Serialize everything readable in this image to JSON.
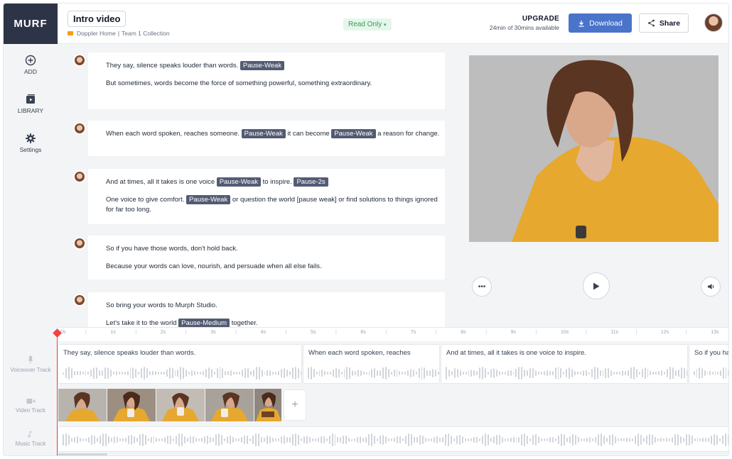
{
  "app": {
    "logo": "MURF"
  },
  "sidebar": {
    "items": [
      {
        "label": "ADD",
        "icon": "plus-circle-icon"
      },
      {
        "label": "LIBRARY",
        "icon": "library-icon"
      },
      {
        "label": "Settings",
        "icon": "gear-icon"
      }
    ]
  },
  "header": {
    "title": "Intro video",
    "breadcrumb": [
      "Doppler Home",
      "|",
      "Team 1 Collection"
    ],
    "mode": "Read Only",
    "mode_caret": "▾",
    "upgrade_label": "UPGRADE",
    "usage": "24min of 30mins available",
    "download_label": "Download",
    "share_label": "Share"
  },
  "script": {
    "blocks": [
      {
        "lines": [
          [
            "They say, silence speaks louder than words.",
            {
              "tag": "Pause-Weak"
            }
          ],
          [
            "But sometimes,   words become the force of something powerful, something extraordinary."
          ]
        ]
      },
      {
        "lines": [
          [
            "When each word spoken, reaches someone.",
            {
              "tag": "Pause-Weak"
            },
            "it can become",
            {
              "tag": "Pause-Weak"
            },
            "a reason for change."
          ]
        ]
      },
      {
        "lines": [
          [
            "And at times, all it takes is one voice",
            {
              "tag": "Pause-Weak"
            },
            "to inspire.",
            {
              "tag": "Pause-2s"
            }
          ],
          [
            "One voice to give comfort.",
            {
              "tag": "Pause-Weak"
            },
            "or question the world  [pause weak] or find solutions to things ignored for far too long."
          ]
        ]
      },
      {
        "lines": [
          [
            "So if you have those words, don't hold back."
          ],
          [
            "Because your words can love, nourish, and persuade when all else fails."
          ]
        ]
      },
      {
        "lines": [
          [
            "So bring your words to Murph Studio."
          ],
          [
            "Let's take it to the world",
            {
              "tag": "Pause-Medium"
            },
            "together."
          ]
        ]
      }
    ]
  },
  "ruler": {
    "labels": [
      "0s",
      "1s",
      "2s",
      "3s",
      "4s",
      "5s",
      "6s",
      "7s",
      "8s",
      "9s",
      "10s",
      "11s",
      "12s",
      "13s"
    ]
  },
  "tracks": {
    "voiceover_label": "Voiceover Track",
    "video_label": "Video Track",
    "music_label": "Music Track",
    "voice_clips": [
      "They say, silence speaks louder than words.",
      "When each word spoken, reaches",
      "And at times, all it takes is one voice to inspire.",
      "So if you ha"
    ],
    "add_clip": "+"
  },
  "colors": {
    "accent": "#4a74c9",
    "sidebar_logo": "#2e3447",
    "tag": "#535b73",
    "playhead": "#ef4444",
    "readonly_text": "#2f9e55"
  }
}
